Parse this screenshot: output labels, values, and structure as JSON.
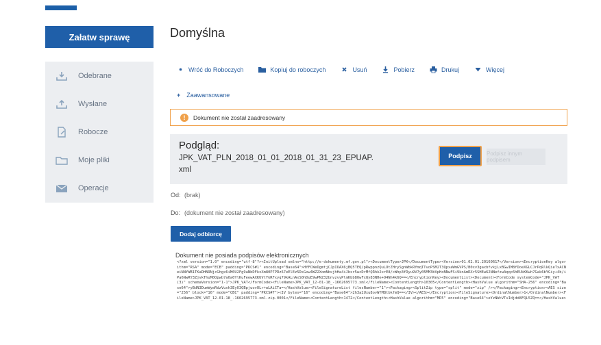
{
  "sidebar": {
    "cta_label": "Załatw sprawę",
    "items": [
      {
        "label": "Odebrane",
        "icon": "inbox-download-icon"
      },
      {
        "label": "Wysłane",
        "icon": "outbox-upload-icon"
      },
      {
        "label": "Robocze",
        "icon": "document-edit-icon"
      },
      {
        "label": "Moje pliki",
        "icon": "folder-icon"
      },
      {
        "label": "Operacje",
        "icon": "envelope-icon"
      }
    ]
  },
  "main": {
    "title": "Domyślna",
    "toolbar": [
      {
        "label": "Wróć do Roboczych",
        "icon": "bullet-icon"
      },
      {
        "label": "Kopiuj do roboczych",
        "icon": "folder-icon"
      },
      {
        "label": "Usuń",
        "icon": "close-icon"
      },
      {
        "label": "Pobierz",
        "icon": "download-icon"
      },
      {
        "label": "Drukuj",
        "icon": "print-icon"
      },
      {
        "label": "Więcej",
        "icon": "caret-down-icon"
      }
    ],
    "advanced_label": "Zaawansowane",
    "warning": "Dokument nie został zaadresowany",
    "preview": {
      "label": "Podgląd:",
      "filename": "JPK_VAT_PLN_2018_01_01_2018_01_31_23_EPUAP.xml",
      "sign_label": "Podpisz",
      "sign_other_label": "Podpisz innym podpisem"
    },
    "from_label": "Od:",
    "from_value": "(brak)",
    "to_label": "Do:",
    "to_value": "(dokument nie został zaadresowany)",
    "add_recipient_label": "Dodaj odbiorcę",
    "no_signatures": "Dokument nie posiada podpisów elektronicznych",
    "xml_content": "<?xml version=\"1.0\" encoding=\"utf-8\"?><InitUpload xmlns=\"http://e-dokumenty.mf.gov.pl\"><DocumentType>JPK</DocumentType><Version>01.02.01.20160617</Version><EncryptionKey algorithm=\"RSA\" mode=\"ECB\" padding=\"PKCS#1\" encoding=\"Base64\">HYFCWeDgmtjCJpIOAX6jBQ5TEQ/pRwppnzQuLOtZHrySgnWbkRYmqTTvoPSM2T3QpxaWmGVPS/B0xv3gaxbfvkjLxBGwIM8fDoeXGLCJrPqRlkQieTxACNeiNNYWB1TKaDHN9NjcGhgx6iM0U2Fg9aNbDFkxXm80P7PRz67eElEz5DsGxw4WZ2XomNbxjhHa4iJbxr5wcDrMfQRhk2xrE8/cWhp3fDyu9V7y05MM3bVpHoNNwFSi9knAmRXr5SHEw62NNefzwAqqc6hEUkKKwh7Gak6bYGiy+4b/iPa6NwRY3ZjvkThuM0Opwb7a0a0YlKuFeewAXKUVtYkRFxyq79kALnAxS0hDuE9wPNZ32bnvzvyPlmKbb8OwFxQy83NHe+O4Nh4k6Q==</EncryptionKey><DocumentList><Document><FormCode systemCode=\"JPK_VAT (3)\" schemaVersion=\"1-1\">JPK_VAT</FormCode><FileName>JPK_VAT_12-01-18_-1662695773.xml</FileName><ContentLength>10305</ContentLength><HashValue algorithm=\"SHA-256\" encoding=\"Base64\">yBdN3DumWywRdzVuxh3EyO3QBpjuovULr+wLAiCTa=</HashValue><FileSignatureList filesNumber=\"1\"><Packaging><SplitZip type=\"split\" mode=\"zip\" /></Packaging><Encryption><AES size=\"256\" block=\"16\" mode=\"CBC\" padding=\"PKCS#7\"><IV bytes=\"16\" encoding=\"Base64\">2h3a2Uxu8ovWfM8tbkfmQ==</IV></AES></Encryption><FileSignature><OrdinalNumber>1</OrdinalNumber><FileName>JPK_VAT_12-01-18_-1662695773.xml.zip.0001</FileName><ContentLength>1472</ContentLength><HashValue algorithm=\"MD5\" encoding=\"Base64\">eYzNWcVTvIdjdd8FQL5ZQ==</HashValue>"
  }
}
